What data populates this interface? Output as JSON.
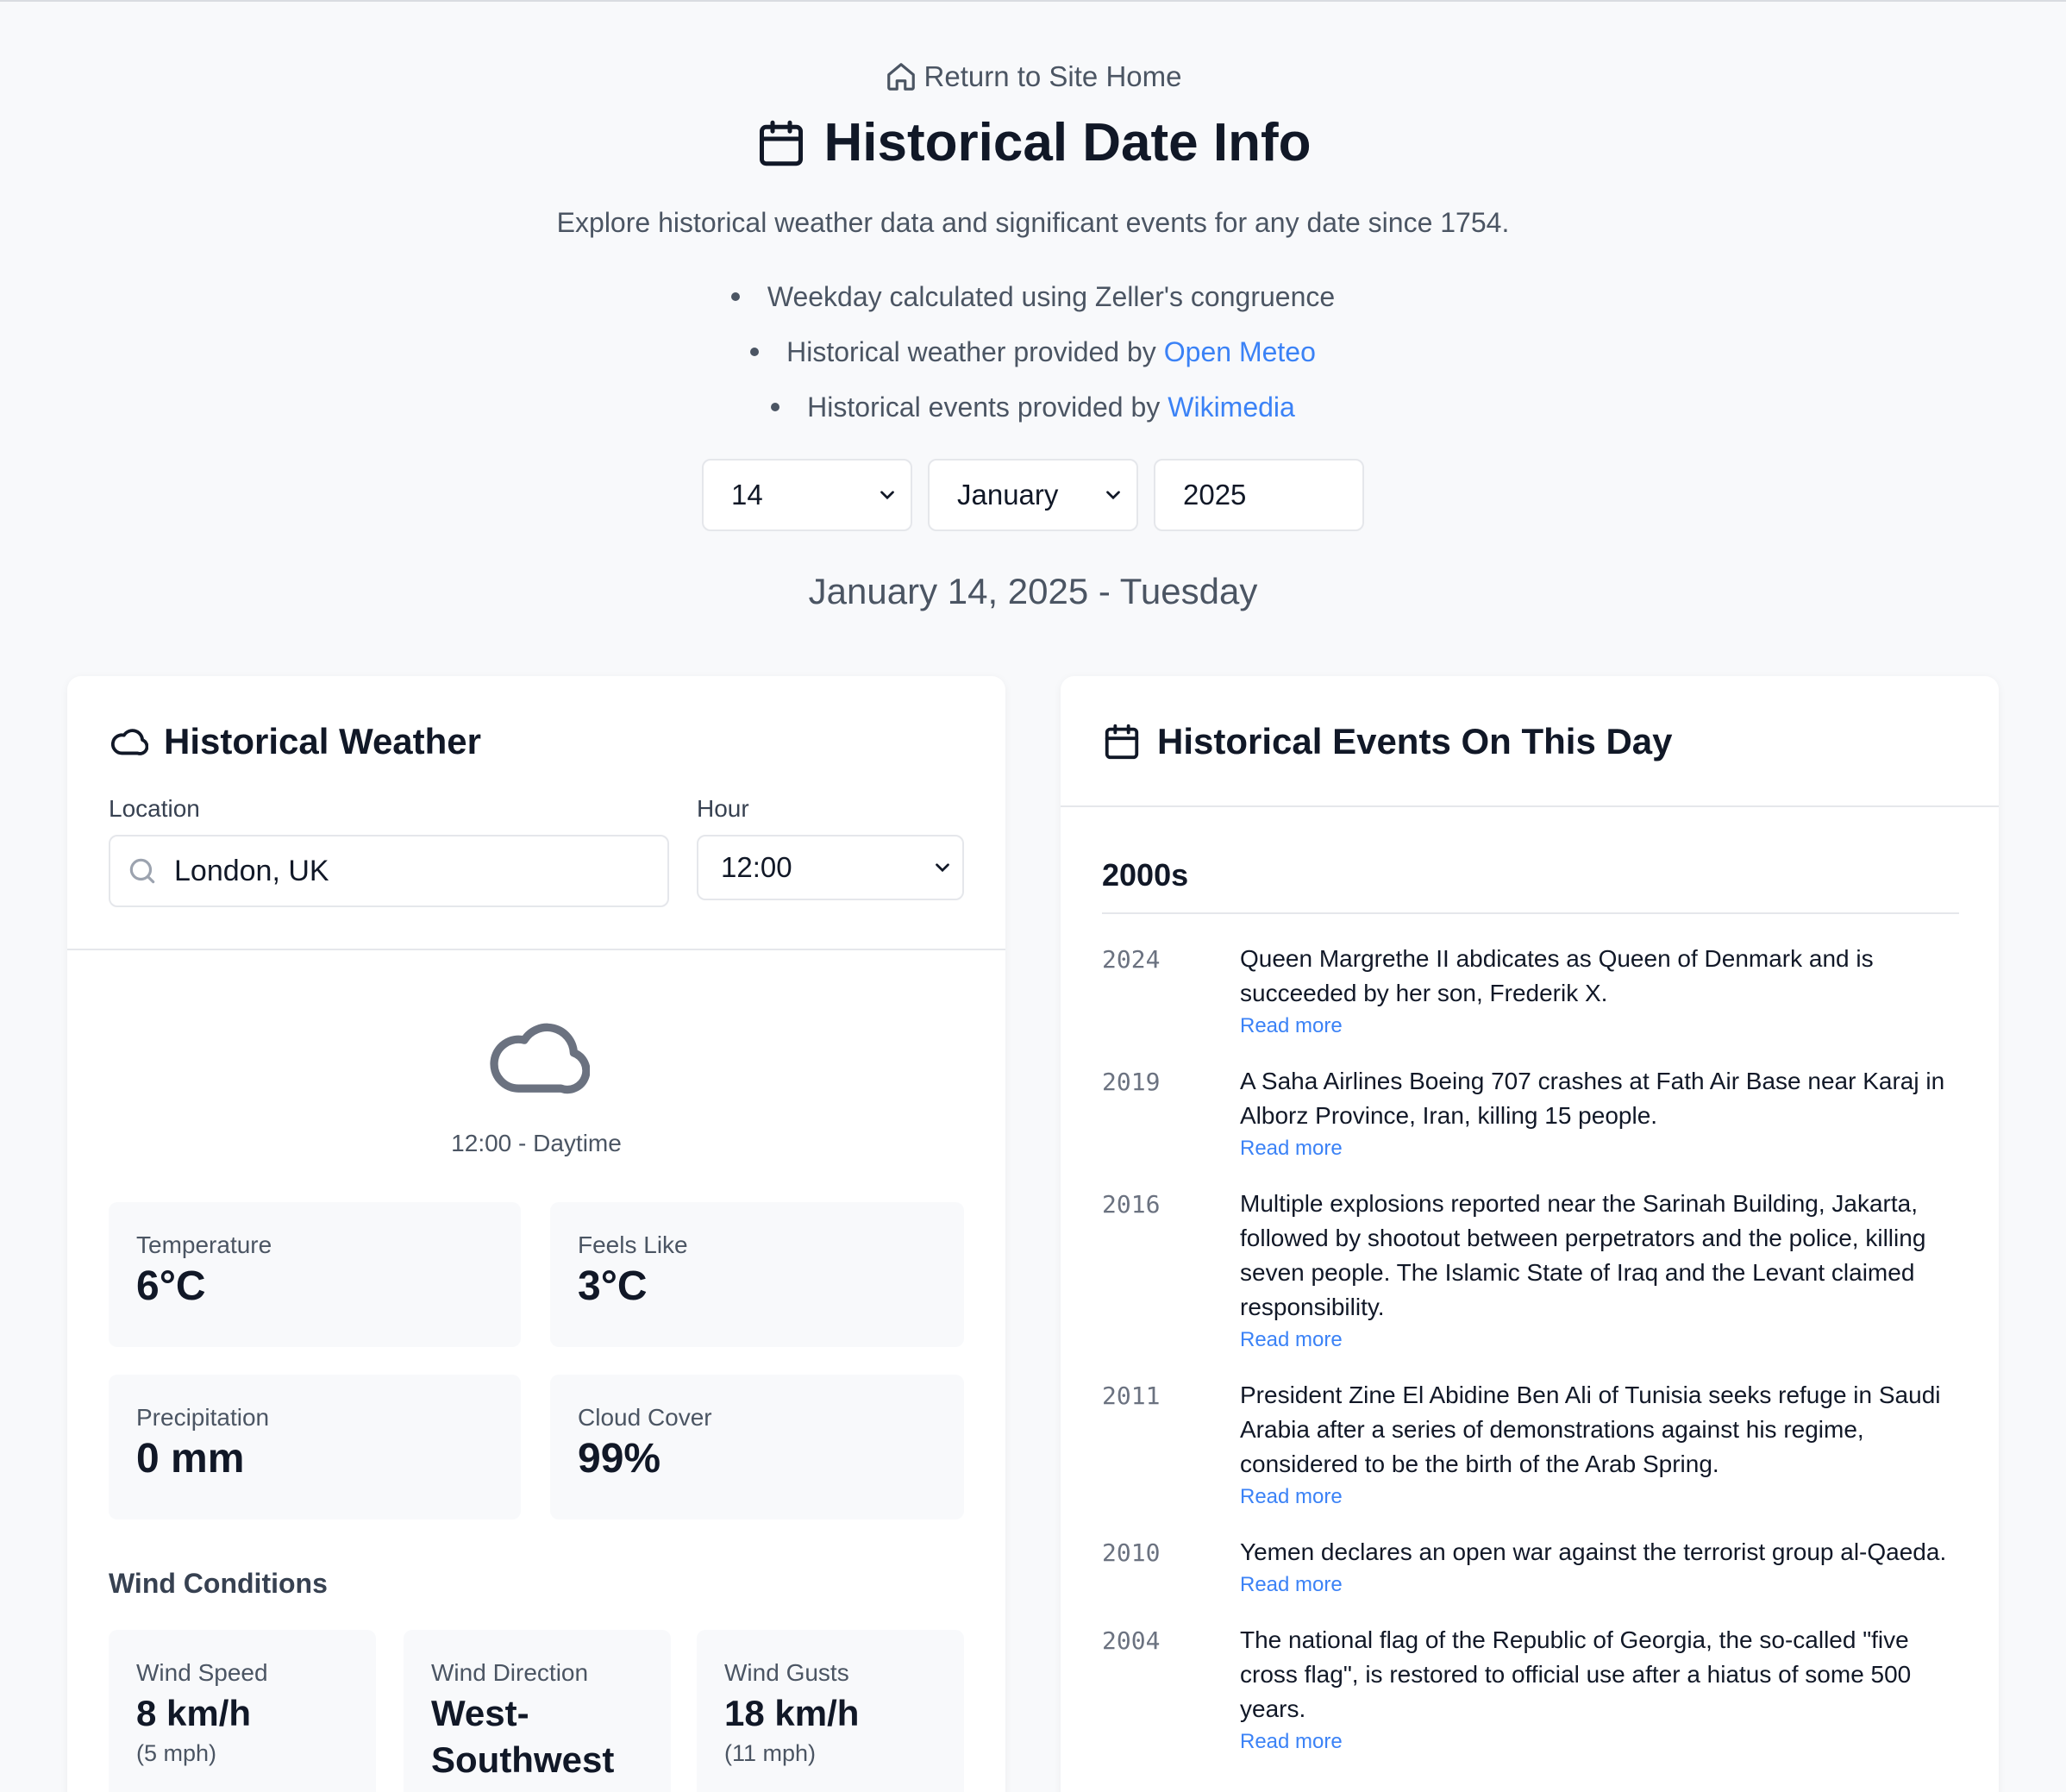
{
  "header": {
    "home_link": "Return to Site Home",
    "title": "Historical Date Info",
    "subtitle": "Explore historical weather data and significant events for any date since 1754.",
    "bullets": [
      {
        "text": "Weekday calculated using Zeller's congruence",
        "link": ""
      },
      {
        "text": "Historical weather provided by",
        "link": "Open Meteo"
      },
      {
        "text": "Historical events provided by",
        "link": "Wikimedia"
      }
    ]
  },
  "date": {
    "day": "14",
    "month": "January",
    "year": "2025",
    "display": "January 14, 2025 - Tuesday"
  },
  "weather": {
    "title": "Historical Weather",
    "location_label": "Location",
    "location_value": "London, UK",
    "hour_label": "Hour",
    "hour_value": "12:00",
    "icon": "cloud-icon",
    "condition": "12:00 - Daytime",
    "stats": [
      {
        "label": "Temperature",
        "value": "6°C"
      },
      {
        "label": "Feels Like",
        "value": "3°C"
      },
      {
        "label": "Precipitation",
        "value": "0 mm"
      },
      {
        "label": "Cloud Cover",
        "value": "99%"
      }
    ],
    "wind_title": "Wind Conditions",
    "wind": [
      {
        "label": "Wind Speed",
        "value": "8 km/h",
        "sub": "(5 mph)"
      },
      {
        "label": "Wind Direction",
        "value": "West-Southwest",
        "sub": ""
      },
      {
        "label": "Wind Gusts",
        "value": "18 km/h",
        "sub": "(11 mph)"
      }
    ]
  },
  "events": {
    "title": "Historical Events On This Day",
    "decade": "2000s",
    "read_more": "Read more",
    "items": [
      {
        "year": "2024",
        "text": "Queen Margrethe II abdicates as Queen of Denmark and is succeeded by her son, Frederik X."
      },
      {
        "year": "2019",
        "text": "A Saha Airlines Boeing 707 crashes at Fath Air Base near Karaj in Alborz Province, Iran, killing 15 people."
      },
      {
        "year": "2016",
        "text": "Multiple explosions reported near the Sarinah Building, Jakarta, followed by shootout between perpetrators and the police, killing seven people. The Islamic State of Iraq and the Levant claimed responsibility."
      },
      {
        "year": "2011",
        "text": "President Zine El Abidine Ben Ali of Tunisia seeks refuge in Saudi Arabia after a series of demonstrations against his regime, considered to be the birth of the Arab Spring."
      },
      {
        "year": "2010",
        "text": "Yemen declares an open war against the terrorist group al-Qaeda."
      },
      {
        "year": "2004",
        "text": "The national flag of the Republic of Georgia, the so-called \"five cross flag\", is restored to official use after a hiatus of some 500 years."
      }
    ]
  },
  "colors": {
    "accent": "#3b82f6",
    "text": "#111827",
    "muted": "#4b5563",
    "bg": "#f8f9fb"
  }
}
